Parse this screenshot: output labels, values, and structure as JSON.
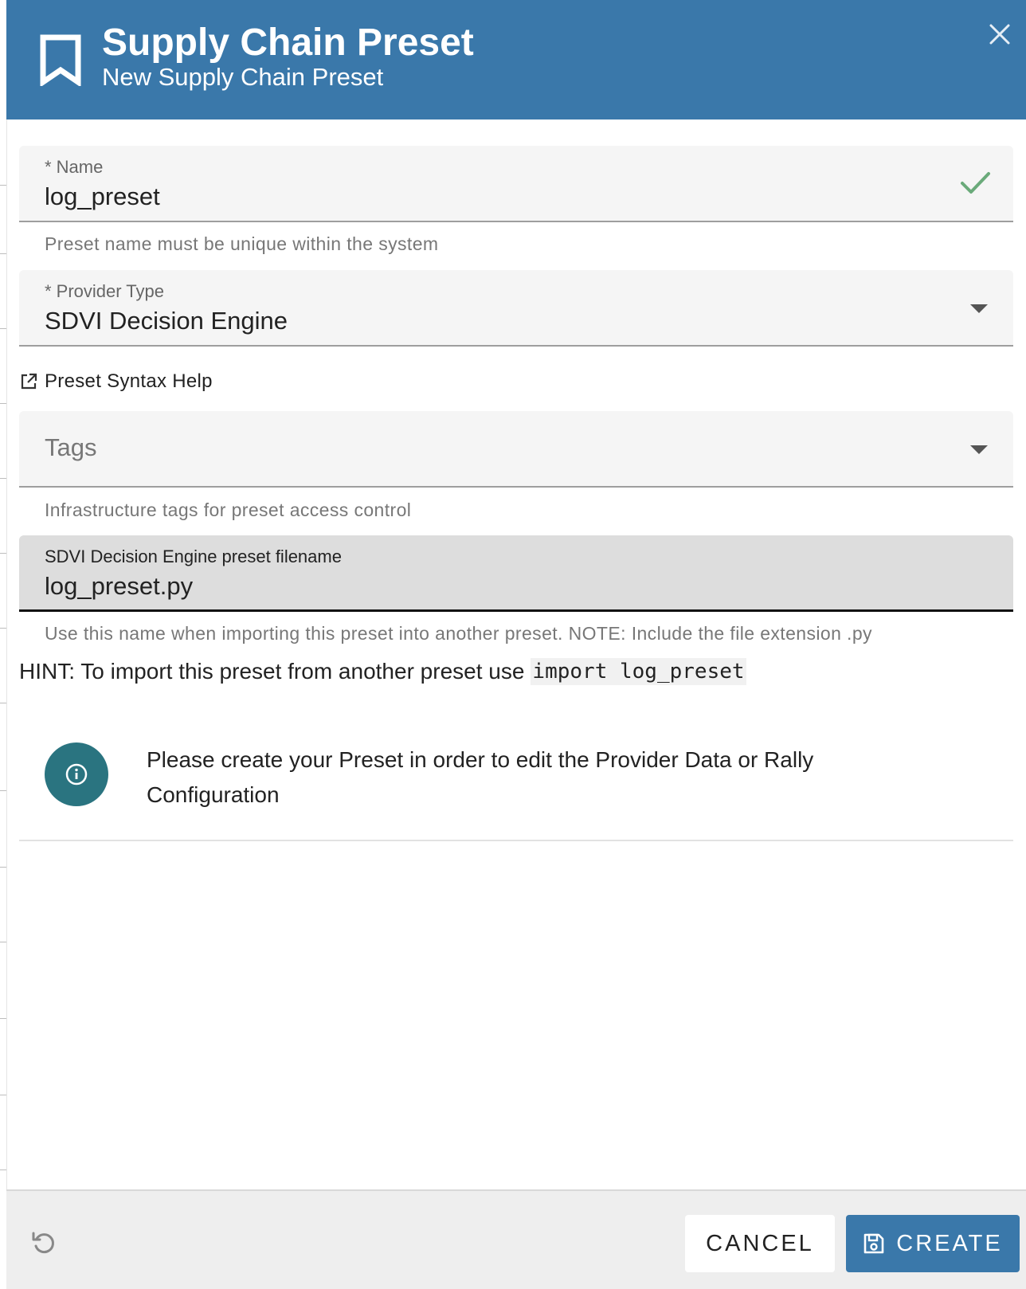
{
  "header": {
    "title": "Supply Chain Preset",
    "subtitle": "New Supply Chain Preset"
  },
  "form": {
    "name": {
      "label": "* Name",
      "value": "log_preset",
      "helper": "Preset name must be unique within the system"
    },
    "provider_type": {
      "label": "* Provider Type",
      "value": "SDVI Decision Engine"
    },
    "syntax_help_link": "Preset Syntax Help",
    "tags": {
      "placeholder": "Tags",
      "helper": "Infrastructure tags for preset access control"
    },
    "filename": {
      "label": "SDVI Decision Engine preset filename",
      "value": "log_preset.py",
      "helper": "Use this name when importing this preset into another preset. NOTE: Include the file extension .py"
    },
    "hint": {
      "text": "HINT: To import this preset from another preset use",
      "code": "import log_preset"
    },
    "info_message": "Please create your Preset in order to edit the Provider Data or Rally Configuration"
  },
  "footer": {
    "cancel_label": "CANCEL",
    "create_label": "CREATE"
  },
  "colors": {
    "header_bg": "#3a78aa",
    "primary_button": "#3a78aa",
    "info_circle": "#2a7480",
    "valid_check": "#6aaa7a"
  },
  "icons": {
    "header": "bookmark-icon",
    "close": "close-icon",
    "valid": "check-icon",
    "dropdown": "caret-down-icon",
    "link": "external-link-icon",
    "info": "info-icon",
    "reset": "undo-icon",
    "save": "save-icon"
  }
}
